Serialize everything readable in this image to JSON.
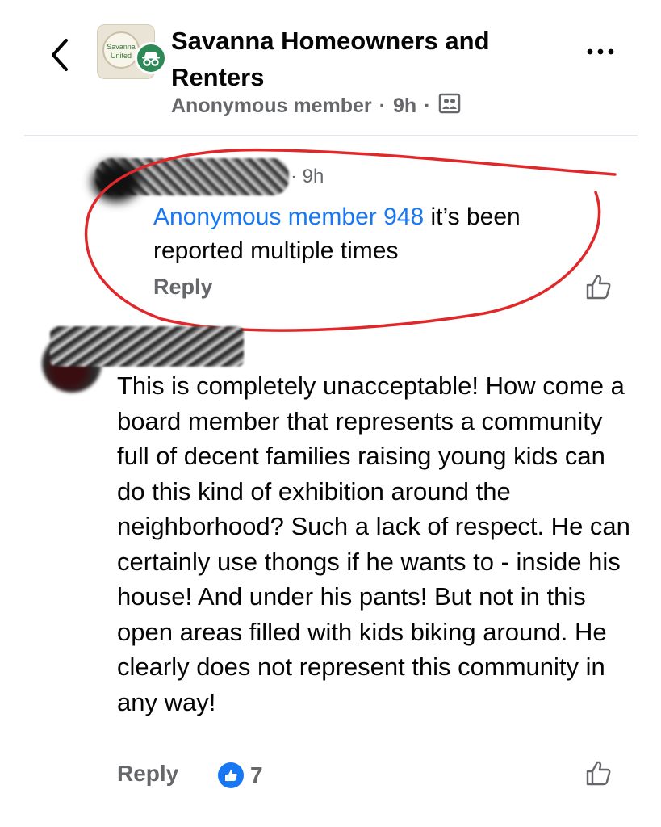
{
  "header": {
    "group_name": "Savanna Homeowners and Renters",
    "post_author": "Anonymous member",
    "post_time": "9h",
    "avatar_text": "Savanna United"
  },
  "comments": [
    {
      "author": "(blurred)",
      "time": "9h",
      "mention": "Anonymous member 948",
      "text": " it’s been reported multiple times",
      "reply_label": "Reply"
    },
    {
      "author": "(blurred)",
      "text": "This is completely unacceptable! How come a board member that represents a community full of decent families raising young kids can do this kind of exhibition around the neighborhood? Such a lack of respect. He can certainly use thongs if he wants to - inside his house! And under his pants! But not in this open areas filled with kids biking around. He clearly does not represent this community in any way!",
      "reply_label": "Reply",
      "reaction_count": "7"
    }
  ],
  "icons": {
    "back": "chevron-left-icon",
    "more": "more-horizontal-icon",
    "audience": "members-icon",
    "like": "thumbs-up-icon",
    "incognito": "incognito-icon"
  },
  "colors": {
    "link": "#1877f2",
    "meta": "#65676b",
    "annotation": "#e0282b",
    "incognito": "#2d8a57"
  }
}
